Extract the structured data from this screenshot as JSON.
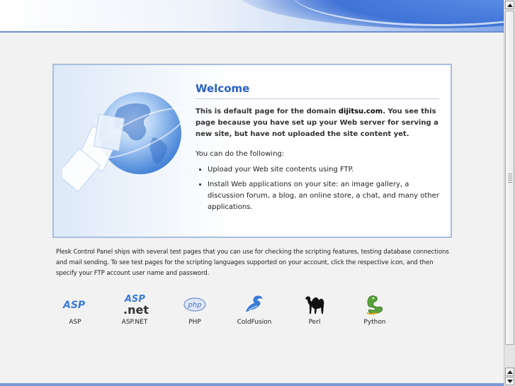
{
  "welcome": {
    "title": "Welcome",
    "intro_pre": "This is default page for the domain ",
    "domain": "dijitsu.com",
    "intro_post": ". You see this page because you have set up your Web server for serving a new site, but have not uploaded the site content yet.",
    "lead": "You can do the following:",
    "items": [
      "Upload your Web site contents using FTP.",
      "Install Web applications on your site: an image gallery, a discussion forum, a blog, an online store, a chat, and many other applications."
    ]
  },
  "description": "Plesk Control Panel ships with several test pages that you can use for checking the scripting features, testing database connections and mail sending. To see test pages for the scripting languages supported on your account, click the respective icon, and then specify your FTP account user name and password.",
  "technologies": [
    {
      "label": "ASP",
      "icon": "asp-icon"
    },
    {
      "label": "ASP.NET",
      "icon": "aspnet-icon"
    },
    {
      "label": "PHP",
      "icon": "php-icon"
    },
    {
      "label": "ColdFusion",
      "icon": "coldfusion-icon"
    },
    {
      "label": "Perl",
      "icon": "perl-camel-icon"
    },
    {
      "label": "Python",
      "icon": "python-snake-icon"
    }
  ],
  "icon_text": {
    "asp": "ASP",
    "aspnet_top": "ASP",
    "aspnet_bottom": ".net",
    "php": "php"
  },
  "colors": {
    "accent": "#2a62c4",
    "banner_blue": "#3f73d6",
    "box_border": "#a9bedf"
  }
}
